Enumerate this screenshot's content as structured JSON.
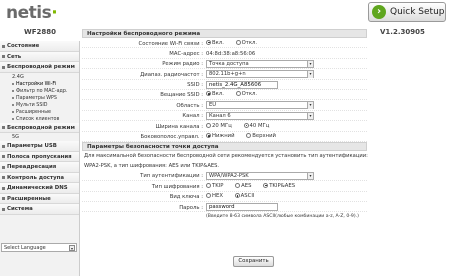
{
  "brand": {
    "logo": "netis",
    "logo_dot_color": "#7fb800"
  },
  "header": {
    "quick_setup_label": "Quick Setup",
    "accent": "#5fa61e"
  },
  "device": {
    "model": "WF2880",
    "version": "V1.2.30905"
  },
  "sidebar": {
    "items": [
      {
        "label": "Состояние"
      },
      {
        "label": "Сеть"
      },
      {
        "label": "Беспроводной режим"
      }
    ],
    "band": "2.4G",
    "wireless_sub": [
      {
        "label": "Настройки Wi-Fi",
        "active": true
      },
      {
        "label": "Фильтр по МАС-адр."
      },
      {
        "label": "Параметры WPS"
      },
      {
        "label": "Мульти SSID"
      },
      {
        "label": "Расширенные"
      },
      {
        "label": "Список клиентов"
      }
    ],
    "wireless2": {
      "label": "Беспроводной режим"
    },
    "band5": "5G",
    "items_after": [
      {
        "label": "Параметры USB"
      },
      {
        "label": "Полоса пропускания"
      },
      {
        "label": "Переадресация"
      },
      {
        "label": "Контроль доступа"
      },
      {
        "label": "Динамический DNS"
      },
      {
        "label": "Расширенные"
      },
      {
        "label": "Система"
      }
    ],
    "language_select": "Select Language"
  },
  "wireless": {
    "title": "Настройки беспроводного режима",
    "wifi_status": {
      "label": "Состояние Wi-Fi связи :",
      "on": "Вкл.",
      "off": "Откл."
    },
    "mac": {
      "label": "МАС-адрес :",
      "value": "04:8d:38:a8:56:06"
    },
    "radio_mode": {
      "label": "Режим радио :",
      "value": "Точка доступа"
    },
    "radio_band": {
      "label": "Диапаз. радиочастот :",
      "value": "802.11b+g+n"
    },
    "ssid": {
      "label": "SSID :",
      "value": "netis_2.4G_A85606"
    },
    "ssid_broadcast": {
      "label": "Вещание SSID :",
      "on": "Вкл.",
      "off": "Откл."
    },
    "region": {
      "label": "Область :",
      "value": "EU"
    },
    "channel": {
      "label": "Канал :",
      "value": "Канал 6"
    },
    "channel_width": {
      "label": "Ширина канала :",
      "opt1": "20 МГц",
      "opt2": "40 МГц"
    },
    "sideband": {
      "label": "Боковополос.управл. :",
      "opt1": "Нижний",
      "opt2": "Верхний"
    }
  },
  "security": {
    "title": "Параметры безопасности точки доступа",
    "note_line1": "Для максимальной безопасности беспроводной сети рекомендуется установить тип аутентификации:",
    "note_line2": "WPA2-PSK, а тип шифрования: AES или TKIP&AES.",
    "auth_type": {
      "label": "Тип аутентификации :",
      "value": "WPA/WPA2-PSK"
    },
    "encryption": {
      "label": "Тип шифрования :",
      "opt1": "TKIP",
      "opt2": "AES",
      "opt3": "TKIP&AES"
    },
    "key_format": {
      "label": "Вид ключа :",
      "opt1": "HEX",
      "opt2": "ASCII"
    },
    "password": {
      "label": "Пароль :",
      "value": "password"
    },
    "hint": "(Введите 8-63 символа ASCII(любые комбинации a-z, A-Z, 0-9).)",
    "save_label": "Сохранить"
  }
}
